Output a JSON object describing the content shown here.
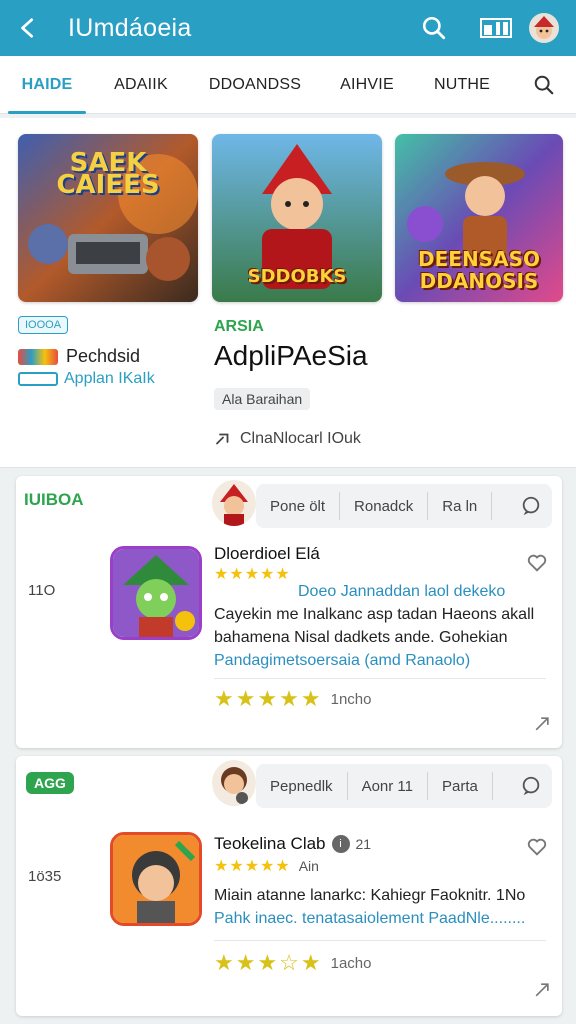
{
  "appbar": {
    "title": "IUmdáoeia",
    "back_icon": "back-arrow-icon",
    "search_icon": "search-icon",
    "toolbar_icon": "panel-icon",
    "avatar_icon": "avatar-icon",
    "color": "#2a9fc4"
  },
  "tabs": [
    {
      "label": "HAIDE",
      "active": true
    },
    {
      "label": "ADAIIK"
    },
    {
      "label": "DDOANDSS"
    },
    {
      "label": "AIHVIE"
    },
    {
      "label": "NUTHE"
    }
  ],
  "featured": {
    "thumbs": [
      {
        "caption": "SAEK CAIEES"
      },
      {
        "caption": "SDDOBKS"
      },
      {
        "caption": "DEENSASO DDANOSIS"
      }
    ],
    "chip": "IOOOA",
    "left_title": "Pechdsid",
    "left_sub": "Applan IKaIk",
    "app_tag": "ARSIA",
    "app_name": "AdpliPAeSia",
    "pill": "Ala Baraihan",
    "download_label": "ClnaNlocarl IOuk"
  },
  "card1": {
    "tag": "IUIBOA",
    "segments": [
      "Pone ölt",
      "Ronadck",
      "Ra ln"
    ],
    "side_num": "11O",
    "title": "Dloerdioel Elá",
    "stars_small": "★★★★★",
    "desc_line1": "Doeo Jannaddan laol dekeko",
    "desc_line2": "Cayekin me Inalkanc asp tadan Haeons akall",
    "desc_line3": "bahamena Nisal dadkets ande. Gohekian",
    "desc_line4": "Pandagimetsoersaia (amd Ranaolo)",
    "stars_rating": "★★★★★",
    "rating_count": "1ncho"
  },
  "card2": {
    "tag": "AGG",
    "segments": [
      "Pepnedlk",
      "Aonr 11",
      "Parta"
    ],
    "side_num": "1ö35",
    "title": "Teokelina Clab",
    "title_badge": "21",
    "stars_small": "★★★★★",
    "stars_note": "Ain",
    "desc_line1": "Miain atanne lanarkc: Kahiegr Faoknitr. 1No",
    "desc_line2": "Pahk inaec. tenatasaiolement PaadNle........",
    "stars_rating": "★★★☆★",
    "rating_count": "1acho"
  }
}
